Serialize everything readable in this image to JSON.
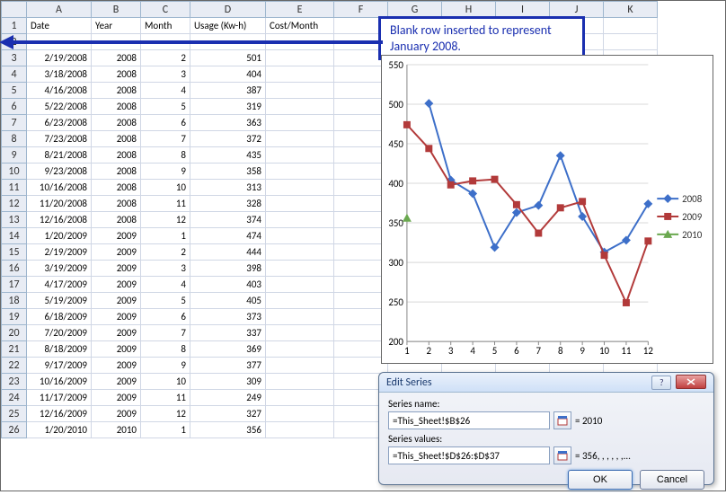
{
  "columns": [
    "A",
    "B",
    "C",
    "D",
    "E",
    "F",
    "G",
    "H",
    "I",
    "J",
    "K"
  ],
  "headers": {
    "A": "Date",
    "B": "Year",
    "C": "Month",
    "D": "Usage (Kw-h)",
    "E": "Cost/Month"
  },
  "rows": [
    {
      "n": 2,
      "A": "",
      "B": "",
      "C": "",
      "D": "",
      "E": ""
    },
    {
      "n": 3,
      "A": "2/19/2008",
      "B": "2008",
      "C": "2",
      "D": "501",
      "E": ""
    },
    {
      "n": 4,
      "A": "3/18/2008",
      "B": "2008",
      "C": "3",
      "D": "404",
      "E": ""
    },
    {
      "n": 5,
      "A": "4/16/2008",
      "B": "2008",
      "C": "4",
      "D": "387",
      "E": ""
    },
    {
      "n": 6,
      "A": "5/22/2008",
      "B": "2008",
      "C": "5",
      "D": "319",
      "E": ""
    },
    {
      "n": 7,
      "A": "6/23/2008",
      "B": "2008",
      "C": "6",
      "D": "363",
      "E": ""
    },
    {
      "n": 8,
      "A": "7/23/2008",
      "B": "2008",
      "C": "7",
      "D": "372",
      "E": ""
    },
    {
      "n": 9,
      "A": "8/21/2008",
      "B": "2008",
      "C": "8",
      "D": "435",
      "E": ""
    },
    {
      "n": 10,
      "A": "9/23/2008",
      "B": "2008",
      "C": "9",
      "D": "358",
      "E": ""
    },
    {
      "n": 11,
      "A": "10/16/2008",
      "B": "2008",
      "C": "10",
      "D": "313",
      "E": ""
    },
    {
      "n": 12,
      "A": "11/20/2008",
      "B": "2008",
      "C": "11",
      "D": "328",
      "E": ""
    },
    {
      "n": 13,
      "A": "12/16/2008",
      "B": "2008",
      "C": "12",
      "D": "374",
      "E": ""
    },
    {
      "n": 14,
      "A": "1/20/2009",
      "B": "2009",
      "C": "1",
      "D": "474",
      "E": ""
    },
    {
      "n": 15,
      "A": "2/19/2009",
      "B": "2009",
      "C": "2",
      "D": "444",
      "E": ""
    },
    {
      "n": 16,
      "A": "3/19/2009",
      "B": "2009",
      "C": "3",
      "D": "398",
      "E": ""
    },
    {
      "n": 17,
      "A": "4/17/2009",
      "B": "2009",
      "C": "4",
      "D": "403",
      "E": ""
    },
    {
      "n": 18,
      "A": "5/19/2009",
      "B": "2009",
      "C": "5",
      "D": "405",
      "E": ""
    },
    {
      "n": 19,
      "A": "6/18/2009",
      "B": "2009",
      "C": "6",
      "D": "373",
      "E": ""
    },
    {
      "n": 20,
      "A": "7/20/2009",
      "B": "2009",
      "C": "7",
      "D": "337",
      "E": ""
    },
    {
      "n": 21,
      "A": "8/18/2009",
      "B": "2009",
      "C": "8",
      "D": "369",
      "E": ""
    },
    {
      "n": 22,
      "A": "9/17/2009",
      "B": "2009",
      "C": "9",
      "D": "377",
      "E": ""
    },
    {
      "n": 23,
      "A": "10/16/2009",
      "B": "2009",
      "C": "10",
      "D": "309",
      "E": ""
    },
    {
      "n": 24,
      "A": "11/17/2009",
      "B": "2009",
      "C": "11",
      "D": "249",
      "E": ""
    },
    {
      "n": 25,
      "A": "12/16/2009",
      "B": "2009",
      "C": "12",
      "D": "327",
      "E": ""
    },
    {
      "n": 26,
      "A": "1/20/2010",
      "B": "2010",
      "C": "1",
      "D": "356",
      "E": ""
    }
  ],
  "callout": "Blank row inserted to represent January 2008.",
  "dialog": {
    "title": "Edit Series",
    "name_label": "Series name:",
    "name_value": "=This_Sheet!$B$26",
    "name_result": "= 2010",
    "values_label": "Series values:",
    "values_value": "=This_Sheet!$D$26:$D$37",
    "values_result": "= 356, , , , , ,...",
    "ok": "OK",
    "cancel": "Cancel"
  },
  "chart_data": {
    "type": "line",
    "categories": [
      1,
      2,
      3,
      4,
      5,
      6,
      7,
      8,
      9,
      10,
      11,
      12
    ],
    "series": [
      {
        "name": "2008",
        "color": "#3d6fc9",
        "values": [
          null,
          501,
          404,
          387,
          319,
          363,
          372,
          435,
          358,
          313,
          328,
          374
        ]
      },
      {
        "name": "2009",
        "color": "#b23a3a",
        "values": [
          474,
          444,
          398,
          403,
          405,
          373,
          337,
          369,
          377,
          309,
          249,
          327
        ]
      },
      {
        "name": "2010",
        "color": "#6aa84f",
        "values": [
          356,
          null,
          null,
          null,
          null,
          null,
          null,
          null,
          null,
          null,
          null,
          null
        ]
      }
    ],
    "ylim": [
      200,
      550
    ],
    "yticks": [
      200,
      250,
      300,
      350,
      400,
      450,
      500,
      550
    ]
  }
}
